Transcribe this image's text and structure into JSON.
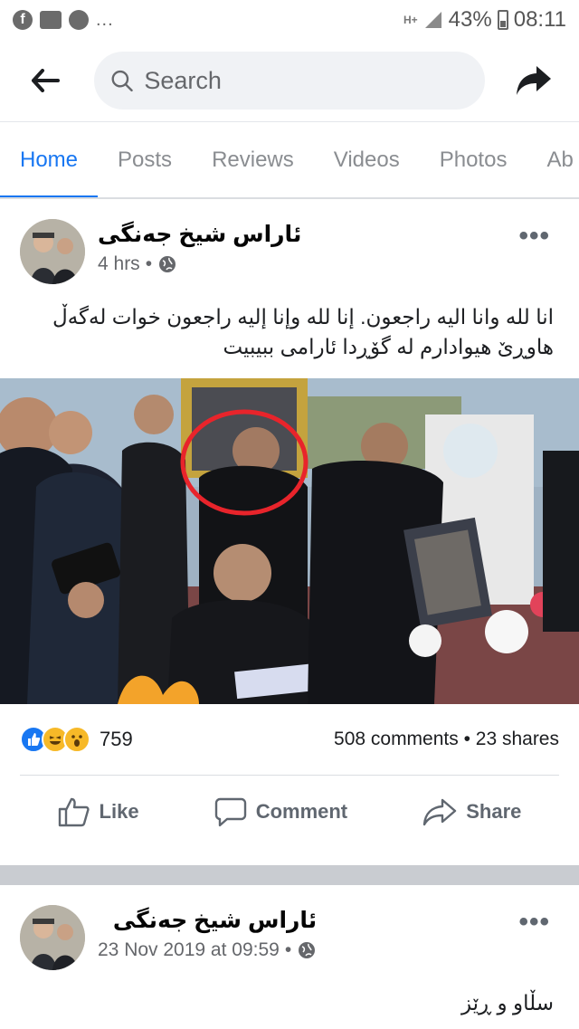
{
  "status_bar": {
    "network": "H+",
    "battery": "43%",
    "time": "08:11",
    "more": "..."
  },
  "header": {
    "search_placeholder": "Search"
  },
  "tabs": [
    {
      "label": "Home"
    },
    {
      "label": "Posts"
    },
    {
      "label": "Reviews"
    },
    {
      "label": "Videos"
    },
    {
      "label": "Photos"
    },
    {
      "label": "Ab"
    }
  ],
  "posts": [
    {
      "author": "ئاراس شیخ جەنگی",
      "time": "4 hrs",
      "text": "انا لله وانا اليه راجعون. إنا لله وإنا إليه راجعون خوات لەگەڵ هاوڕێ هیوادارم لە گۆڕدا ئارامی ببیبیت",
      "reaction_count": "759",
      "stats": "508 comments • 23 shares",
      "actions": {
        "like": "Like",
        "comment": "Comment",
        "share": "Share"
      }
    },
    {
      "author": "ئاراس شیخ جەنگی",
      "time": "23 Nov 2019 at 09:59",
      "text": "سڵاو و ڕێز"
    }
  ],
  "colors": {
    "brand": "#1877f2",
    "highlight_circle": "#e8242b"
  }
}
